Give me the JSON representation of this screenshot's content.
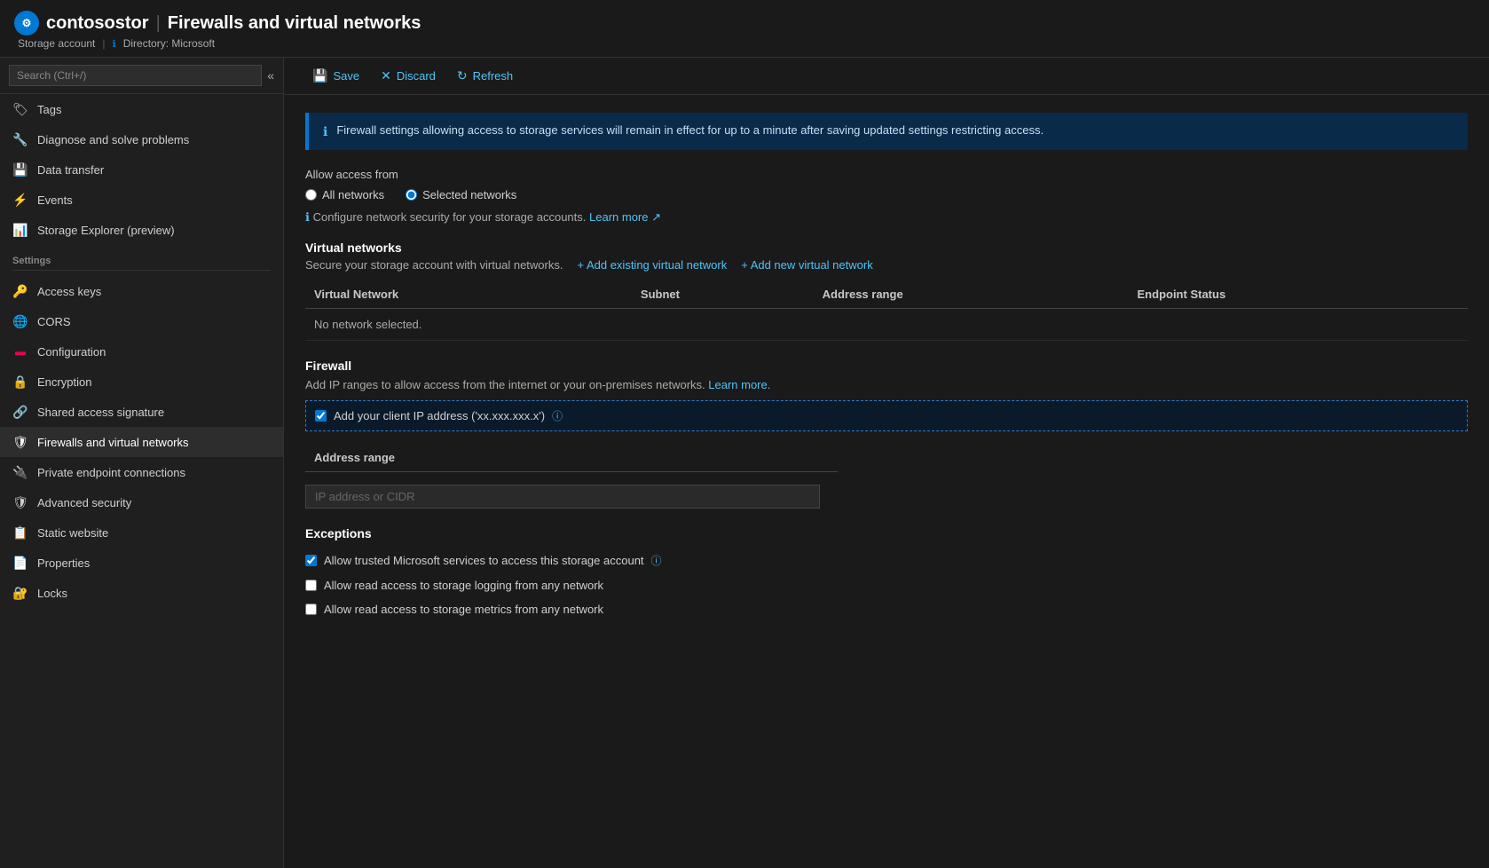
{
  "header": {
    "icon": "⚙",
    "account_name": "contosostor",
    "separator": "|",
    "page_title": "Firewalls and virtual networks",
    "breadcrumb_storage": "Storage account",
    "breadcrumb_directory_label": "Directory: Microsoft"
  },
  "sidebar": {
    "search_placeholder": "Search (Ctrl+/)",
    "collapse_icon": "«",
    "items_top": [
      {
        "id": "tags",
        "label": "Tags",
        "icon": "🏷"
      },
      {
        "id": "diagnose",
        "label": "Diagnose and solve problems",
        "icon": "🔧"
      },
      {
        "id": "data-transfer",
        "label": "Data transfer",
        "icon": "💾"
      },
      {
        "id": "events",
        "label": "Events",
        "icon": "⚡"
      },
      {
        "id": "storage-explorer",
        "label": "Storage Explorer (preview)",
        "icon": "📊"
      }
    ],
    "section_settings": "Settings",
    "items_settings": [
      {
        "id": "access-keys",
        "label": "Access keys",
        "icon": "🔑"
      },
      {
        "id": "cors",
        "label": "CORS",
        "icon": "🌐"
      },
      {
        "id": "configuration",
        "label": "Configuration",
        "icon": "🟥"
      },
      {
        "id": "encryption",
        "label": "Encryption",
        "icon": "🔒"
      },
      {
        "id": "shared-access-signature",
        "label": "Shared access signature",
        "icon": "🔗"
      },
      {
        "id": "firewalls-and-virtual-networks",
        "label": "Firewalls and virtual networks",
        "icon": "🛡",
        "active": true
      },
      {
        "id": "private-endpoint-connections",
        "label": "Private endpoint connections",
        "icon": "🔌"
      },
      {
        "id": "advanced-security",
        "label": "Advanced security",
        "icon": "🛡"
      },
      {
        "id": "static-website",
        "label": "Static website",
        "icon": "📋"
      },
      {
        "id": "properties",
        "label": "Properties",
        "icon": "📄"
      },
      {
        "id": "locks",
        "label": "Locks",
        "icon": "🔐"
      }
    ]
  },
  "toolbar": {
    "save_label": "Save",
    "discard_label": "Discard",
    "refresh_label": "Refresh"
  },
  "info_banner": {
    "text": "Firewall settings allowing access to storage services will remain in effect for up to a minute after saving updated settings restricting access."
  },
  "allow_access": {
    "label": "Allow access from",
    "options": [
      {
        "id": "all-networks",
        "label": "All networks",
        "selected": false
      },
      {
        "id": "selected-networks",
        "label": "Selected networks",
        "selected": true
      }
    ],
    "configure_text": "Configure network security for your storage accounts.",
    "learn_more_label": "Learn more",
    "learn_more_href": "#"
  },
  "virtual_networks": {
    "title": "Virtual networks",
    "description": "Secure your storage account with virtual networks.",
    "add_existing_label": "+ Add existing virtual network",
    "add_new_label": "+ Add new virtual network",
    "table": {
      "columns": [
        "Virtual Network",
        "Subnet",
        "Address range",
        "Endpoint Status"
      ],
      "empty_message": "No network selected."
    }
  },
  "firewall": {
    "title": "Firewall",
    "description": "Add IP ranges to allow access from the internet or your on-premises networks.",
    "learn_more_label": "Learn more.",
    "learn_more_href": "#",
    "add_ip_checkbox_label": "Add your client IP address ('xx.xxx.xxx.x')",
    "add_ip_checked": true,
    "address_range_header": "Address range",
    "ip_placeholder": "IP address or CIDR"
  },
  "exceptions": {
    "title": "Exceptions",
    "items": [
      {
        "id": "trusted-microsoft",
        "label": "Allow trusted Microsoft services to access this storage account",
        "checked": true,
        "has_info": true
      },
      {
        "id": "read-logging",
        "label": "Allow read access to storage logging from any network",
        "checked": false,
        "has_info": false
      },
      {
        "id": "read-metrics",
        "label": "Allow read access to storage metrics from any network",
        "checked": false,
        "has_info": false
      }
    ]
  }
}
